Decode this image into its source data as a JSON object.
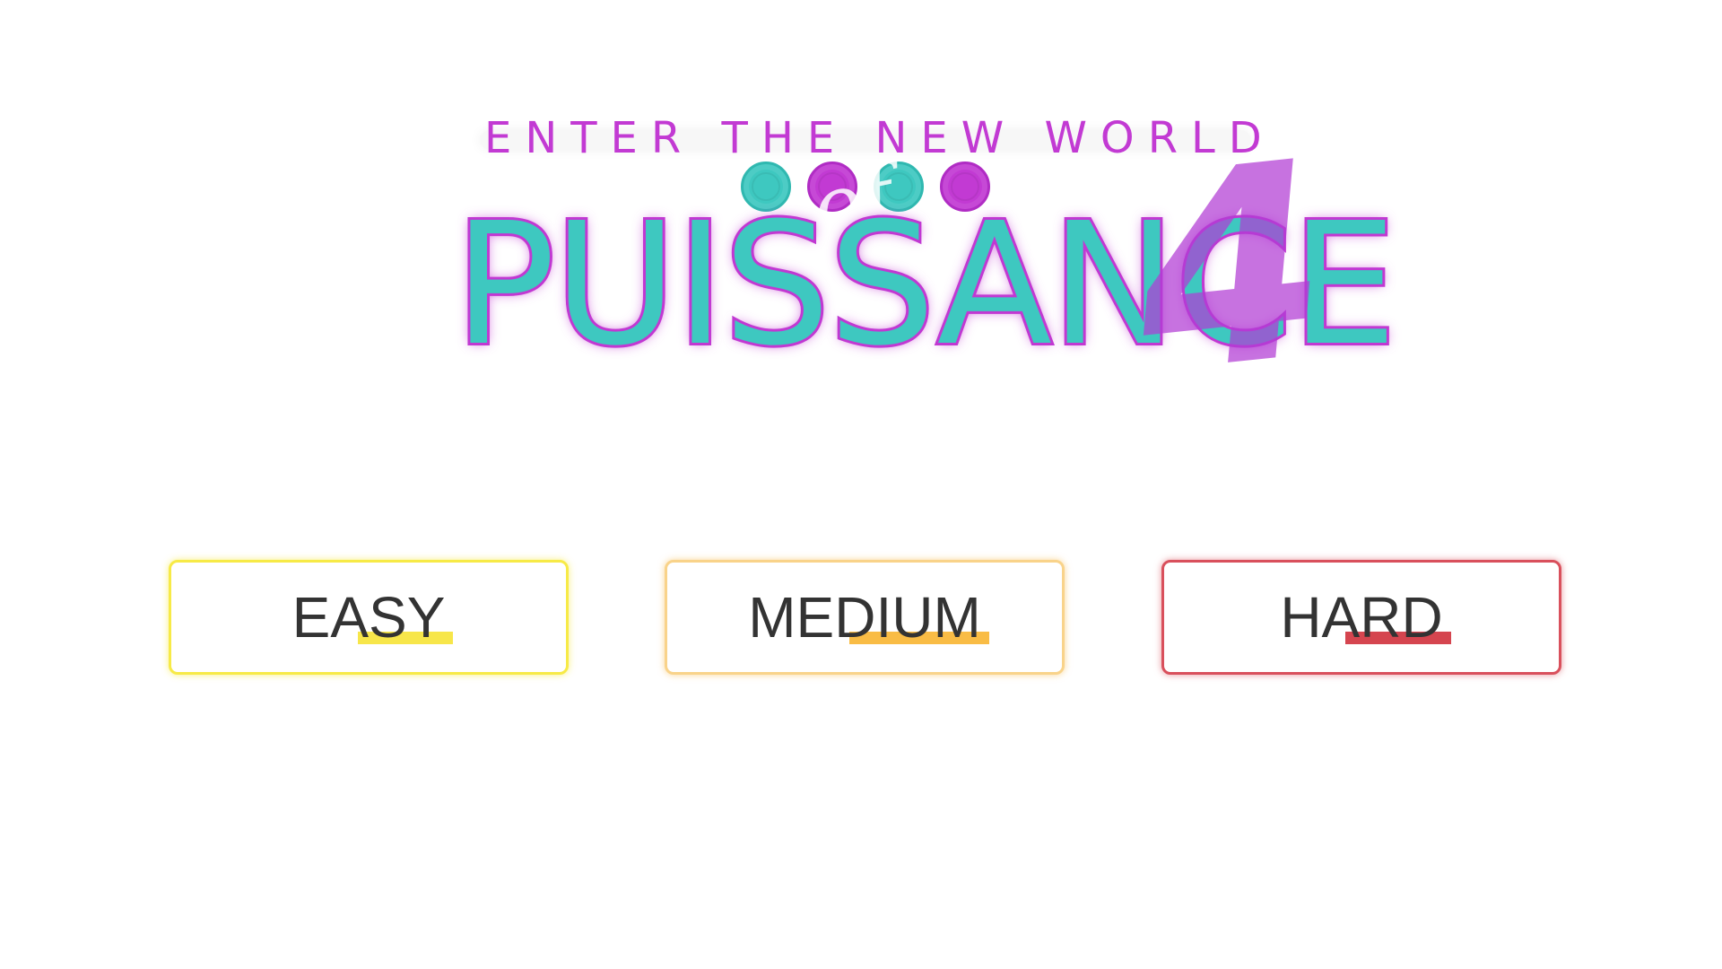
{
  "logo": {
    "tagline": "ENTER THE NEW WORLD",
    "title": "PUISSANCE",
    "title_number": "4",
    "script_word": "of",
    "tokens": [
      "teal",
      "purple",
      "teal",
      "purple"
    ]
  },
  "difficulty": {
    "easy_label": "EASY",
    "medium_label": "MEDIUM",
    "hard_label": "HARD"
  },
  "colors": {
    "teal": "#3ec8c0",
    "purple": "#c23ad3",
    "easy": "#f7e64a",
    "medium": "#f9bc45",
    "hard": "#d5454f",
    "text": "#333333"
  }
}
